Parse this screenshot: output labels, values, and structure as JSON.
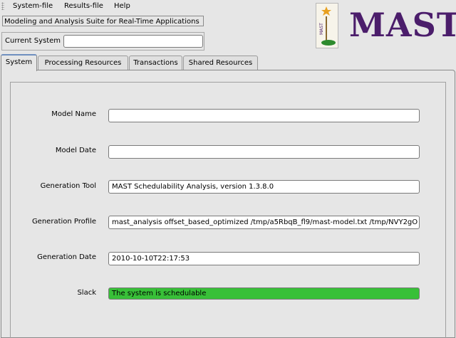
{
  "menubar": {
    "items": [
      "System-file",
      "Results-file",
      "Help"
    ]
  },
  "subtitle": "Modeling and Analysis Suite for Real-Time Applications",
  "current_system": {
    "label": "Current System",
    "value": ""
  },
  "logo": {
    "text": "MAST",
    "color": "#4b1d6b"
  },
  "tabs": [
    {
      "label": "System",
      "active": true
    },
    {
      "label": "Processing Resources",
      "active": false
    },
    {
      "label": "Transactions",
      "active": false
    },
    {
      "label": "Shared Resources",
      "active": false
    }
  ],
  "form": {
    "model_name": {
      "label": "Model Name",
      "value": ""
    },
    "model_date": {
      "label": "Model Date",
      "value": ""
    },
    "generation_tool": {
      "label": "Generation Tool",
      "value": "MAST Schedulability Analysis, version 1.3.8.0"
    },
    "generation_profile": {
      "label": "Generation Profile",
      "value": "mast_analysis offset_based_optimized /tmp/a5RbqB_fl9/mast-model.txt /tmp/NVY2gO"
    },
    "generation_date": {
      "label": "Generation Date",
      "value": "2010-10-10T22:17:53"
    },
    "slack": {
      "label": "Slack",
      "value": "The system is schedulable",
      "color": "#38c038"
    }
  }
}
